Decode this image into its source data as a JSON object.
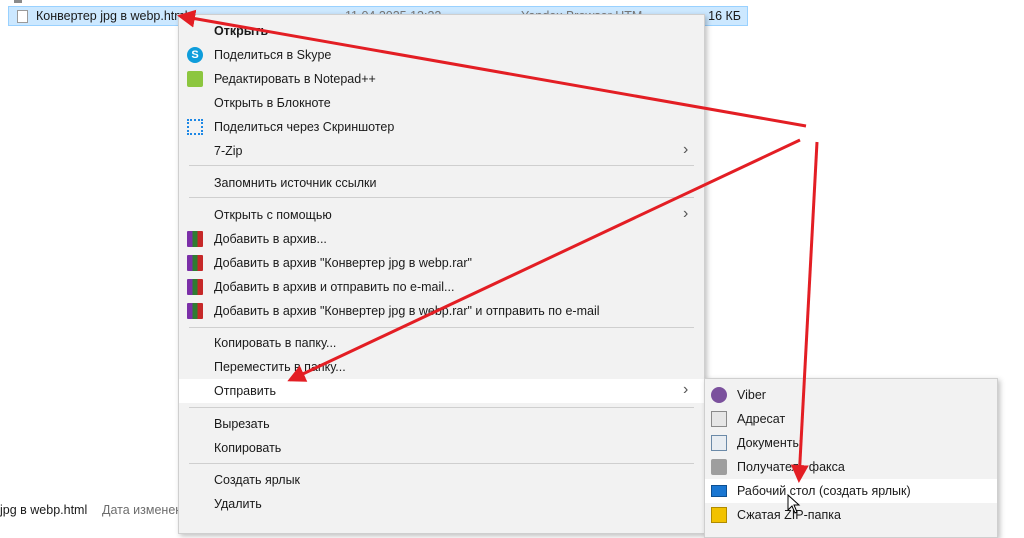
{
  "explorer": {
    "selected_file": {
      "name": "Конвертер jpg в webp.html",
      "date": "11.04.2025 13:32",
      "type": "Yandex Browser HTM...",
      "size": "16 КБ"
    },
    "status_bar": {
      "name": "jpg в webp.html",
      "label": "Дата изменения"
    }
  },
  "context_menu": {
    "items": [
      {
        "label": "Открыть",
        "icon": "none",
        "bold": true
      },
      {
        "label": "Поделиться в Skype",
        "icon": "skype-icon"
      },
      {
        "label": "Редактировать в Notepad++",
        "icon": "notepadpp-icon"
      },
      {
        "label": "Открыть в Блокноте",
        "icon": "none"
      },
      {
        "label": "Поделиться через Скриншотер",
        "icon": "screenshoter-icon"
      },
      {
        "label": "7-Zip",
        "icon": "none",
        "submenu": true
      },
      {
        "label": "Запомнить источник ссылки",
        "icon": "none"
      },
      {
        "label": "Открыть с помощью",
        "icon": "none",
        "submenu": true
      },
      {
        "label": "Добавить в архив...",
        "icon": "winrar-icon"
      },
      {
        "label": "Добавить в архив \"Конвертер jpg в webp.rar\"",
        "icon": "winrar-icon"
      },
      {
        "label": "Добавить в архив и отправить по e-mail...",
        "icon": "winrar-icon"
      },
      {
        "label": "Добавить в архив \"Конвертер jpg в webp.rar\" и отправить по e-mail",
        "icon": "winrar-icon"
      },
      {
        "label": "Копировать в папку...",
        "icon": "none"
      },
      {
        "label": "Переместить в папку...",
        "icon": "none"
      },
      {
        "label": "Отправить",
        "icon": "none",
        "submenu": true,
        "highlighted": true
      },
      {
        "label": "Вырезать",
        "icon": "none"
      },
      {
        "label": "Копировать",
        "icon": "none"
      },
      {
        "label": "Создать ярлык",
        "icon": "none"
      },
      {
        "label": "Удалить",
        "icon": "none"
      }
    ],
    "submenu_arrow": "›"
  },
  "send_to_submenu": {
    "items": [
      {
        "label": "Viber",
        "icon": "viber-icon"
      },
      {
        "label": "Адресат",
        "icon": "mail-recipient-icon"
      },
      {
        "label": "Документы",
        "icon": "documents-icon"
      },
      {
        "label": "Получатель факса",
        "icon": "fax-icon"
      },
      {
        "label": "Рабочий стол (создать ярлык)",
        "icon": "desktop-icon",
        "highlighted": true
      },
      {
        "label": "Сжатая ZIP-папка",
        "icon": "zip-folder-icon"
      }
    ]
  },
  "skype_glyph": "S",
  "colors": {
    "selection": "#cce8ff",
    "menu_bg": "#f2f2f2",
    "arrow_annotation": "#e31e24"
  }
}
